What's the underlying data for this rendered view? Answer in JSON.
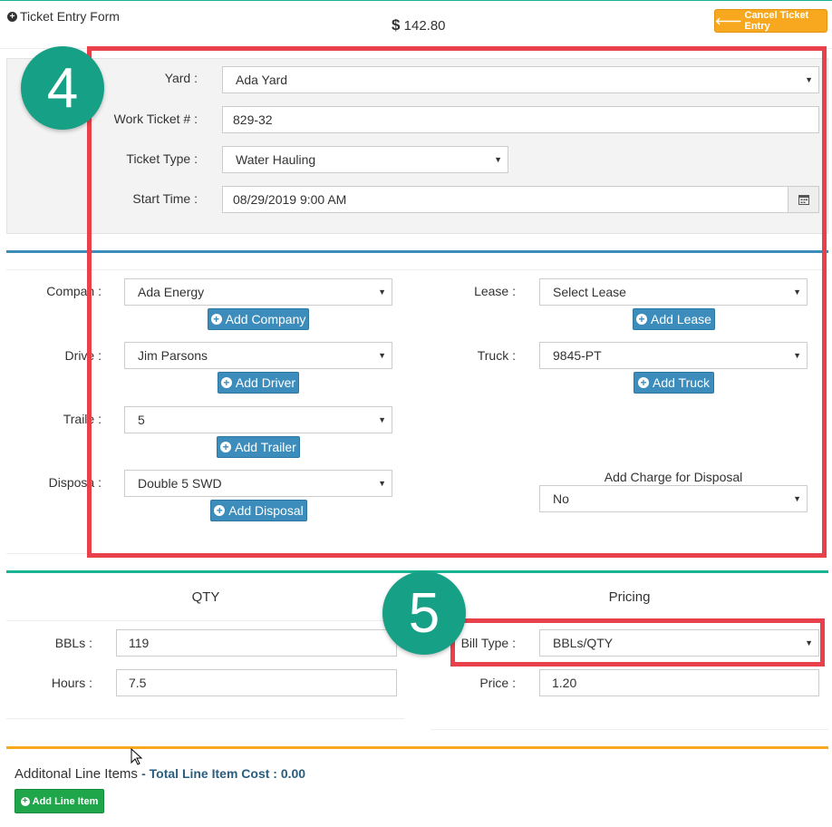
{
  "header": {
    "form_title": "Ticket Entry Form",
    "currency_symbol": "$",
    "total_amount": "142.80",
    "cancel_label": "Cancel Ticket Entry"
  },
  "ticket": {
    "yard_label": "Yard :",
    "yard_value": "Ada Yard",
    "work_ticket_label": "Work Ticket # :",
    "work_ticket_value": "829-32",
    "ticket_type_label": "Ticket Type :",
    "ticket_type_value": "Water Hauling",
    "start_time_label": "Start Time :",
    "start_time_value": "08/29/2019 9:00 AM"
  },
  "details": {
    "company_label": "Compan :",
    "company_value": "Ada Energy",
    "add_company_label": "Add Company",
    "driver_label": "Drive :",
    "driver_value": "Jim Parsons",
    "add_driver_label": "Add Driver",
    "trailer_label": "Traile :",
    "trailer_value": "5",
    "add_trailer_label": "Add Trailer",
    "disposal_label": "Disposa :",
    "disposal_value": "Double 5 SWD",
    "add_disposal_label": "Add Disposal",
    "lease_label": "Lease :",
    "lease_value": "Select Lease",
    "add_lease_label": "Add Lease",
    "truck_label": "Truck :",
    "truck_value": "9845-PT",
    "add_truck_label": "Add Truck",
    "disposal_charge_label": "Add Charge for Disposal",
    "disposal_charge_value": "No"
  },
  "qty": {
    "title": "QTY",
    "bbls_label": "BBLs :",
    "bbls_value": "119",
    "hours_label": "Hours :",
    "hours_value": "7.5"
  },
  "pricing": {
    "title": "Pricing",
    "bill_type_label": "Bill Type :",
    "bill_type_value": "BBLs/QTY",
    "price_label": "Price :",
    "price_value": "1.20"
  },
  "line_items": {
    "title": "Additonal Line Items",
    "total_text": "- Total Line Item Cost : 0.00",
    "add_label": "Add Line Item"
  },
  "annotations": {
    "badge_4": "4",
    "badge_5": "5",
    "highlight_color": "#e8414b",
    "badge_color": "#16a085"
  },
  "colors": {
    "primary_blue": "#3c8dbc",
    "accent_green": "#1ab394",
    "warning_orange": "#f8a81e",
    "success_green": "#1fa64a"
  }
}
